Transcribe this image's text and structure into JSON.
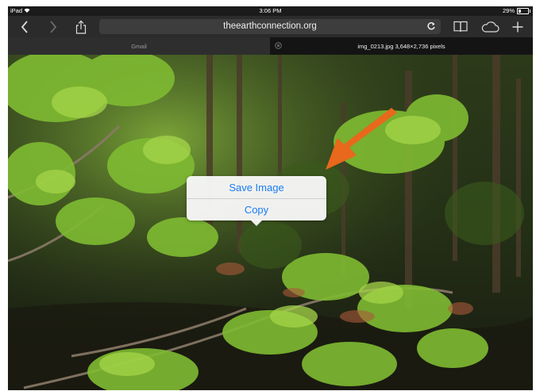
{
  "status_bar": {
    "device": "iPad",
    "time": "3:06 PM",
    "battery": "29%",
    "battery_level": 0.29
  },
  "toolbar": {
    "url": "theearthconnection.org",
    "icons": [
      "back-icon",
      "forward-icon",
      "share-icon",
      "reload-icon",
      "bookmarks-icon",
      "icloud-tabs-icon",
      "new-tab-icon"
    ]
  },
  "tabs": [
    {
      "label": "Gmail",
      "active": false
    },
    {
      "label": "img_0213.jpg 3,648×2,736 pixels",
      "active": true
    }
  ],
  "context_menu": {
    "save_label": "Save Image",
    "copy_label": "Copy"
  },
  "colors": {
    "accent": "#1a7cf5",
    "arrow": "#e8681c",
    "toolbar": "#2b2b2b",
    "foliage": "#6fae2b"
  }
}
